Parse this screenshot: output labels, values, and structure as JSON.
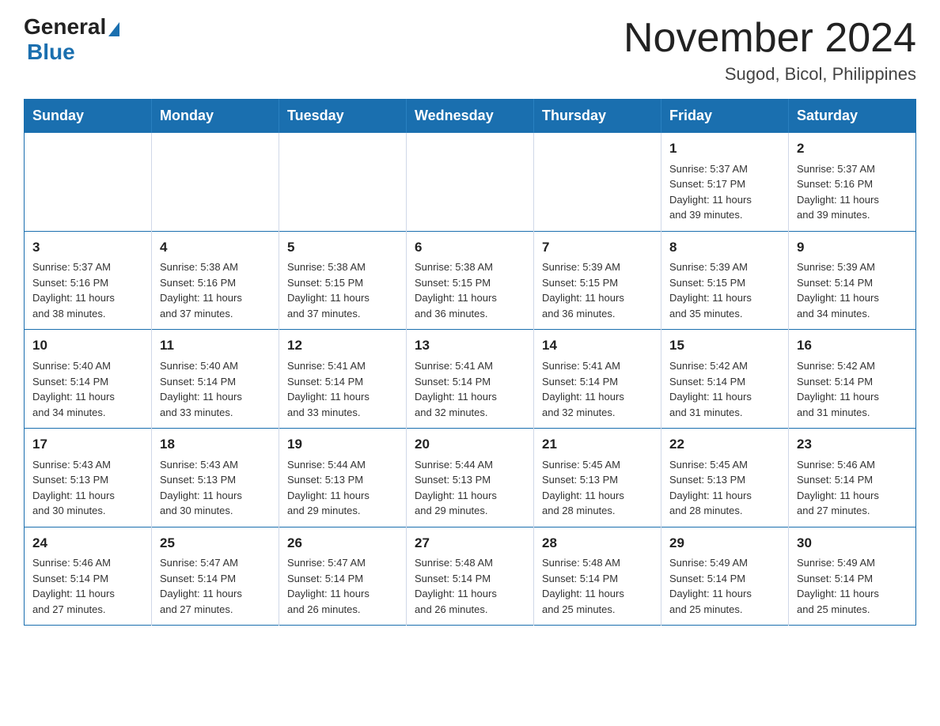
{
  "logo": {
    "general": "General",
    "blue": "Blue"
  },
  "header": {
    "month_title": "November 2024",
    "subtitle": "Sugod, Bicol, Philippines"
  },
  "days_of_week": [
    "Sunday",
    "Monday",
    "Tuesday",
    "Wednesday",
    "Thursday",
    "Friday",
    "Saturday"
  ],
  "weeks": [
    [
      {
        "day": "",
        "info": ""
      },
      {
        "day": "",
        "info": ""
      },
      {
        "day": "",
        "info": ""
      },
      {
        "day": "",
        "info": ""
      },
      {
        "day": "",
        "info": ""
      },
      {
        "day": "1",
        "info": "Sunrise: 5:37 AM\nSunset: 5:17 PM\nDaylight: 11 hours\nand 39 minutes."
      },
      {
        "day": "2",
        "info": "Sunrise: 5:37 AM\nSunset: 5:16 PM\nDaylight: 11 hours\nand 39 minutes."
      }
    ],
    [
      {
        "day": "3",
        "info": "Sunrise: 5:37 AM\nSunset: 5:16 PM\nDaylight: 11 hours\nand 38 minutes."
      },
      {
        "day": "4",
        "info": "Sunrise: 5:38 AM\nSunset: 5:16 PM\nDaylight: 11 hours\nand 37 minutes."
      },
      {
        "day": "5",
        "info": "Sunrise: 5:38 AM\nSunset: 5:15 PM\nDaylight: 11 hours\nand 37 minutes."
      },
      {
        "day": "6",
        "info": "Sunrise: 5:38 AM\nSunset: 5:15 PM\nDaylight: 11 hours\nand 36 minutes."
      },
      {
        "day": "7",
        "info": "Sunrise: 5:39 AM\nSunset: 5:15 PM\nDaylight: 11 hours\nand 36 minutes."
      },
      {
        "day": "8",
        "info": "Sunrise: 5:39 AM\nSunset: 5:15 PM\nDaylight: 11 hours\nand 35 minutes."
      },
      {
        "day": "9",
        "info": "Sunrise: 5:39 AM\nSunset: 5:14 PM\nDaylight: 11 hours\nand 34 minutes."
      }
    ],
    [
      {
        "day": "10",
        "info": "Sunrise: 5:40 AM\nSunset: 5:14 PM\nDaylight: 11 hours\nand 34 minutes."
      },
      {
        "day": "11",
        "info": "Sunrise: 5:40 AM\nSunset: 5:14 PM\nDaylight: 11 hours\nand 33 minutes."
      },
      {
        "day": "12",
        "info": "Sunrise: 5:41 AM\nSunset: 5:14 PM\nDaylight: 11 hours\nand 33 minutes."
      },
      {
        "day": "13",
        "info": "Sunrise: 5:41 AM\nSunset: 5:14 PM\nDaylight: 11 hours\nand 32 minutes."
      },
      {
        "day": "14",
        "info": "Sunrise: 5:41 AM\nSunset: 5:14 PM\nDaylight: 11 hours\nand 32 minutes."
      },
      {
        "day": "15",
        "info": "Sunrise: 5:42 AM\nSunset: 5:14 PM\nDaylight: 11 hours\nand 31 minutes."
      },
      {
        "day": "16",
        "info": "Sunrise: 5:42 AM\nSunset: 5:14 PM\nDaylight: 11 hours\nand 31 minutes."
      }
    ],
    [
      {
        "day": "17",
        "info": "Sunrise: 5:43 AM\nSunset: 5:13 PM\nDaylight: 11 hours\nand 30 minutes."
      },
      {
        "day": "18",
        "info": "Sunrise: 5:43 AM\nSunset: 5:13 PM\nDaylight: 11 hours\nand 30 minutes."
      },
      {
        "day": "19",
        "info": "Sunrise: 5:44 AM\nSunset: 5:13 PM\nDaylight: 11 hours\nand 29 minutes."
      },
      {
        "day": "20",
        "info": "Sunrise: 5:44 AM\nSunset: 5:13 PM\nDaylight: 11 hours\nand 29 minutes."
      },
      {
        "day": "21",
        "info": "Sunrise: 5:45 AM\nSunset: 5:13 PM\nDaylight: 11 hours\nand 28 minutes."
      },
      {
        "day": "22",
        "info": "Sunrise: 5:45 AM\nSunset: 5:13 PM\nDaylight: 11 hours\nand 28 minutes."
      },
      {
        "day": "23",
        "info": "Sunrise: 5:46 AM\nSunset: 5:14 PM\nDaylight: 11 hours\nand 27 minutes."
      }
    ],
    [
      {
        "day": "24",
        "info": "Sunrise: 5:46 AM\nSunset: 5:14 PM\nDaylight: 11 hours\nand 27 minutes."
      },
      {
        "day": "25",
        "info": "Sunrise: 5:47 AM\nSunset: 5:14 PM\nDaylight: 11 hours\nand 27 minutes."
      },
      {
        "day": "26",
        "info": "Sunrise: 5:47 AM\nSunset: 5:14 PM\nDaylight: 11 hours\nand 26 minutes."
      },
      {
        "day": "27",
        "info": "Sunrise: 5:48 AM\nSunset: 5:14 PM\nDaylight: 11 hours\nand 26 minutes."
      },
      {
        "day": "28",
        "info": "Sunrise: 5:48 AM\nSunset: 5:14 PM\nDaylight: 11 hours\nand 25 minutes."
      },
      {
        "day": "29",
        "info": "Sunrise: 5:49 AM\nSunset: 5:14 PM\nDaylight: 11 hours\nand 25 minutes."
      },
      {
        "day": "30",
        "info": "Sunrise: 5:49 AM\nSunset: 5:14 PM\nDaylight: 11 hours\nand 25 minutes."
      }
    ]
  ]
}
